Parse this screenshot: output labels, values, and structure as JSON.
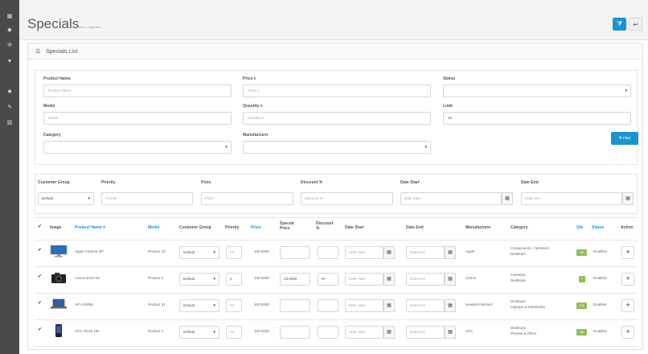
{
  "sidebar": {
    "icons": [
      "dashboard-icon",
      "tag-icon",
      "puzzle-icon",
      "cart-icon",
      "gear-icon",
      "wrench-icon",
      "bar-chart-icon"
    ]
  },
  "header": {
    "title": "Specials",
    "breadcrumb": [
      "Home",
      "Specials"
    ],
    "sep": "/"
  },
  "panel": {
    "title": "Specials List"
  },
  "filter": {
    "product_name_label": "Product Name",
    "product_name_placeholder": "Product Name",
    "price_label": "Price ≥",
    "price_placeholder": "Price ≥",
    "status_label": "Status",
    "model_label": "Model",
    "model_placeholder": "Model",
    "quantity_label": "Quantity ≥",
    "quantity_placeholder": "Quantity ≥",
    "limit_label": "Limit",
    "limit_value": "20",
    "category_label": "Category",
    "manufacturer_label": "Manufacturer",
    "filter_button": "Filter"
  },
  "special_filter": {
    "customer_group_label": "Customer Group",
    "customer_group_value": "Default",
    "priority_label": "Priority",
    "priority_placeholder": "Priority",
    "price_label": "Price",
    "price_placeholder": "Price",
    "discount_label": "Discount %",
    "discount_placeholder": "Discount %",
    "date_start_label": "Date Start",
    "date_start_placeholder": "Date Start",
    "date_end_label": "Date End",
    "date_end_placeholder": "Date End"
  },
  "table": {
    "headers": {
      "image": "Image",
      "product_name": "Product Name ▾",
      "model": "Model",
      "customer_group": "Customer Group",
      "priority": "Priority",
      "price": "Price",
      "special_price": "Special Price",
      "discount": "Discount %",
      "date_start": "Date Start",
      "date_end": "Date End",
      "manufacturer": "Manufacturer",
      "category": "Category",
      "qty": "Qty",
      "status": "Status",
      "action": "Action"
    },
    "rows": [
      {
        "name": "Apple Cinema 30\"",
        "model": "Product 15",
        "group": "Default",
        "priority": "Pri",
        "price": "100.0000",
        "special": "",
        "discount": "",
        "date_start": "Date Start",
        "date_end": "Date End",
        "manufacturer": "Apple",
        "category1": "Components > Monitors",
        "category2": "Desktops",
        "qty": "990",
        "status": "Enabled",
        "image": "monitor"
      },
      {
        "name": "Canon EOS 5D",
        "model": "Product 3",
        "group": "Default",
        "priority": "0",
        "price": "100.0000",
        "special": "33.0000",
        "discount": "67",
        "date_start": "Date Start",
        "date_end": "Date End",
        "manufacturer": "Canon",
        "category1": "Cameras",
        "category2": "Desktops",
        "qty": "7",
        "status": "Enabled",
        "image": "camera"
      },
      {
        "name": "HP LP3065",
        "model": "Product 21",
        "group": "Default",
        "priority": "Pri",
        "price": "100.0000",
        "special": "",
        "discount": "",
        "date_start": "Date Start",
        "date_end": "Date End",
        "manufacturer": "Hewlett-Packard",
        "category1": "Desktops",
        "category2": "Laptops & Notebooks",
        "qty": "1000",
        "status": "Enabled",
        "image": "laptop"
      },
      {
        "name": "HTC Touch HD",
        "model": "Product 1",
        "group": "Default",
        "priority": "Pri",
        "price": "100.0000",
        "special": "",
        "discount": "",
        "date_start": "Date Start",
        "date_end": "Date End",
        "manufacturer": "HTC",
        "category1": "Desktops",
        "category2": "Phones & PDAs",
        "qty": "939",
        "status": "Enabled",
        "image": "phone"
      }
    ]
  },
  "colors": {
    "accent": "#1e91cf",
    "sidebar": "#4a4a4a",
    "qty_badge": "#8fbc5a"
  }
}
